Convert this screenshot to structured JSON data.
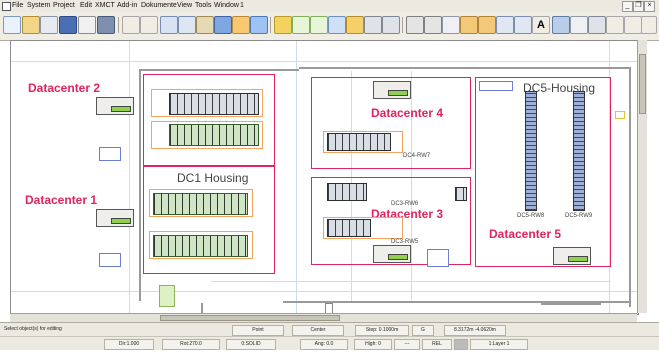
{
  "menu": {
    "items": [
      "File",
      "System",
      "Project",
      "Edit",
      "XMCT",
      "Add-in",
      "Dokumente",
      "View",
      "Tools",
      "Window",
      "1"
    ]
  },
  "toolbar": {
    "text_tool": "A"
  },
  "window_controls": [
    "_",
    "❐",
    "×"
  ],
  "canvas": {
    "datacenters": [
      "Datacenter 2",
      "Datacenter 1",
      "Datacenter 4",
      "Datacenter 3",
      "Datacenter 5"
    ],
    "housing_labels": [
      "DC1 Housing",
      "DC5-Housing"
    ],
    "row_labels": [
      "DC4-RW7",
      "DC3-RW6",
      "DC3-RW5",
      "DC5-RW8",
      "DC5-RW9"
    ]
  },
  "status": {
    "prompt": "Select object(s) for editing",
    "snap_point": "Point",
    "snap_center": "Center",
    "step": "Step: 0.1000m",
    "g": "G",
    "coords": "8.3172m  -4.0620m",
    "dir": "Dir:1.000",
    "rot": "Rot:270.0",
    "solid": "0:SOLID",
    "ang": "Ang: 0.0",
    "high": "High: 0",
    "dash": "---",
    "rel": "REL",
    "layer": "1:Layer 1"
  },
  "colors": {
    "accent": "#e0245e",
    "grid": "#cfdcef",
    "rack_dark": "#3a3f48",
    "rack_green": "#8fd14f",
    "panel": "#ece9e0"
  }
}
